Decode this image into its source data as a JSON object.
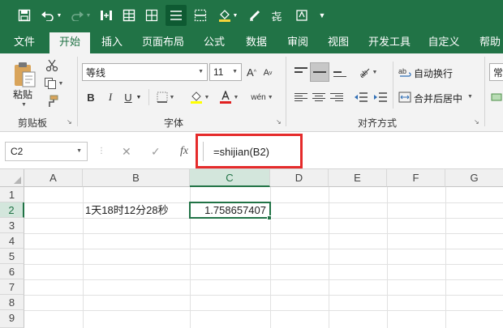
{
  "colors": {
    "brand": "#217346",
    "highlight": "#e52b2b"
  },
  "qat": {
    "icons": [
      "save-icon",
      "undo-icon",
      "redo-icon",
      "freeze-icon",
      "table-icon",
      "grid-icon",
      "align-icon",
      "border-icon",
      "fill-icon",
      "clear-icon",
      "phonetic-icon",
      "highlight-icon",
      "more-icon"
    ]
  },
  "tabs": [
    "文件",
    "开始",
    "插入",
    "页面布局",
    "公式",
    "数据",
    "审阅",
    "视图",
    "开发工具",
    "自定义",
    "帮助"
  ],
  "ribbon": {
    "clipboard": {
      "paste_label": "粘贴",
      "group_label": "剪贴板"
    },
    "font": {
      "name": "等线",
      "size": "11",
      "group_label": "字体",
      "bold": "B",
      "italic": "I",
      "underline": "U",
      "grow": "A",
      "shrink": "A",
      "phonetic": "wén"
    },
    "alignment": {
      "wrap_label": "自动换行",
      "merge_label": "合并后居中",
      "group_label": "对齐方式"
    },
    "number": {
      "format_partial": "常"
    }
  },
  "formula_bar": {
    "name_box": "C2",
    "cancel": "✕",
    "enter": "✓",
    "fx": "fx",
    "formula": "=shijian(B2)"
  },
  "sheet": {
    "columns": [
      "A",
      "B",
      "C",
      "D",
      "E",
      "F",
      "G"
    ],
    "rows": [
      "1",
      "2",
      "3",
      "4",
      "5",
      "6",
      "7",
      "8",
      "9"
    ],
    "cells": {
      "B2": "1天18时12分28秒",
      "C2": "1.758657407"
    },
    "active_cell": "C2"
  }
}
